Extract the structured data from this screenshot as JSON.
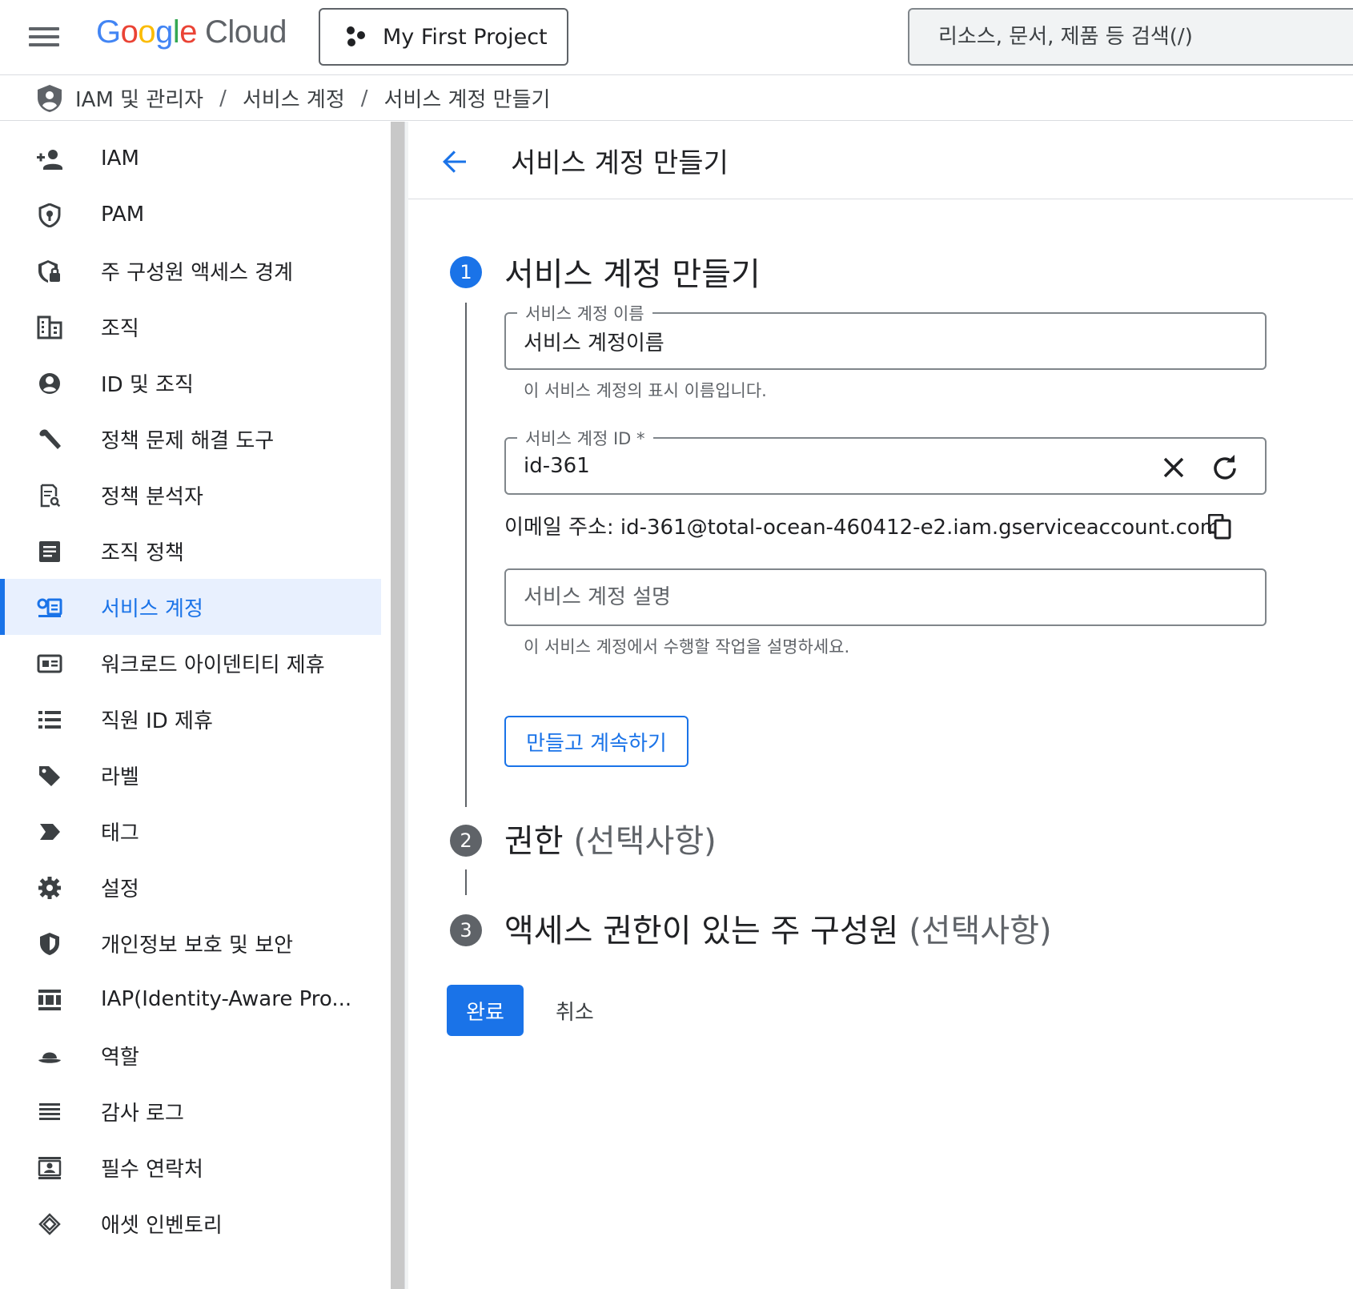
{
  "topbar": {
    "logo_google": [
      "G",
      "o",
      "o",
      "g",
      "l",
      "e"
    ],
    "logo_cloud": "Cloud",
    "project_name": "My First Project",
    "search_placeholder": "리소스, 문서, 제품 등 검색(/)"
  },
  "breadcrumb": {
    "items": [
      "IAM 및 관리자",
      "서비스 계정",
      "서비스 계정 만들기"
    ],
    "separator": "/"
  },
  "sidebar": {
    "items": [
      {
        "label": "IAM",
        "icon": "person-add-icon"
      },
      {
        "label": "PAM",
        "icon": "shield-key-icon"
      },
      {
        "label": "주 구성원 액세스 경계",
        "icon": "shield-lock-icon"
      },
      {
        "label": "조직",
        "icon": "building-icon"
      },
      {
        "label": "ID 및 조직",
        "icon": "account-circle-icon"
      },
      {
        "label": "정책 문제 해결 도구",
        "icon": "wrench-icon"
      },
      {
        "label": "정책 분석자",
        "icon": "document-search-icon"
      },
      {
        "label": "조직 정책",
        "icon": "article-icon"
      },
      {
        "label": "서비스 계정",
        "icon": "service-account-icon",
        "active": true
      },
      {
        "label": "워크로드 아이덴티티 제휴",
        "icon": "id-card-icon"
      },
      {
        "label": "직원 ID 제휴",
        "icon": "list-icon"
      },
      {
        "label": "라벨",
        "icon": "tag-icon"
      },
      {
        "label": "태그",
        "icon": "label-arrow-icon"
      },
      {
        "label": "설정",
        "icon": "gear-icon"
      },
      {
        "label": "개인정보 보호 및 보안",
        "icon": "shield-icon"
      },
      {
        "label": "IAP(Identity-Aware Pro...",
        "icon": "iap-icon"
      },
      {
        "label": "역할",
        "icon": "hat-icon"
      },
      {
        "label": "감사 로그",
        "icon": "lines-icon"
      },
      {
        "label": "필수 연락처",
        "icon": "contact-icon"
      },
      {
        "label": "애셋 인벤토리",
        "icon": "diamond-layers-icon"
      }
    ]
  },
  "main": {
    "page_title": "서비스 계정 만들기",
    "step1": {
      "number": "1",
      "title": "서비스 계정 만들기",
      "name_label": "서비스 계정 이름",
      "name_value": "서비스 계정이름",
      "name_hint": "이 서비스 계정의 표시 이름입니다.",
      "id_label": "서비스 계정 ID *",
      "id_value": "id-361",
      "email_text": "이메일 주소: id-361@total-ocean-460412-e2.iam.gserviceaccount.com",
      "desc_placeholder": "서비스 계정 설명",
      "desc_hint": "이 서비스 계정에서 수행할 작업을 설명하세요.",
      "continue_label": "만들고 계속하기"
    },
    "step2": {
      "number": "2",
      "title": "권한",
      "optional": "(선택사항)"
    },
    "step3": {
      "number": "3",
      "title": "액세스 권한이 있는 주 구성원",
      "optional": "(선택사항)"
    },
    "done_label": "완료",
    "cancel_label": "취소"
  },
  "colors": {
    "accent": "#1a73e8",
    "active_bg": "#e8f0fe"
  }
}
